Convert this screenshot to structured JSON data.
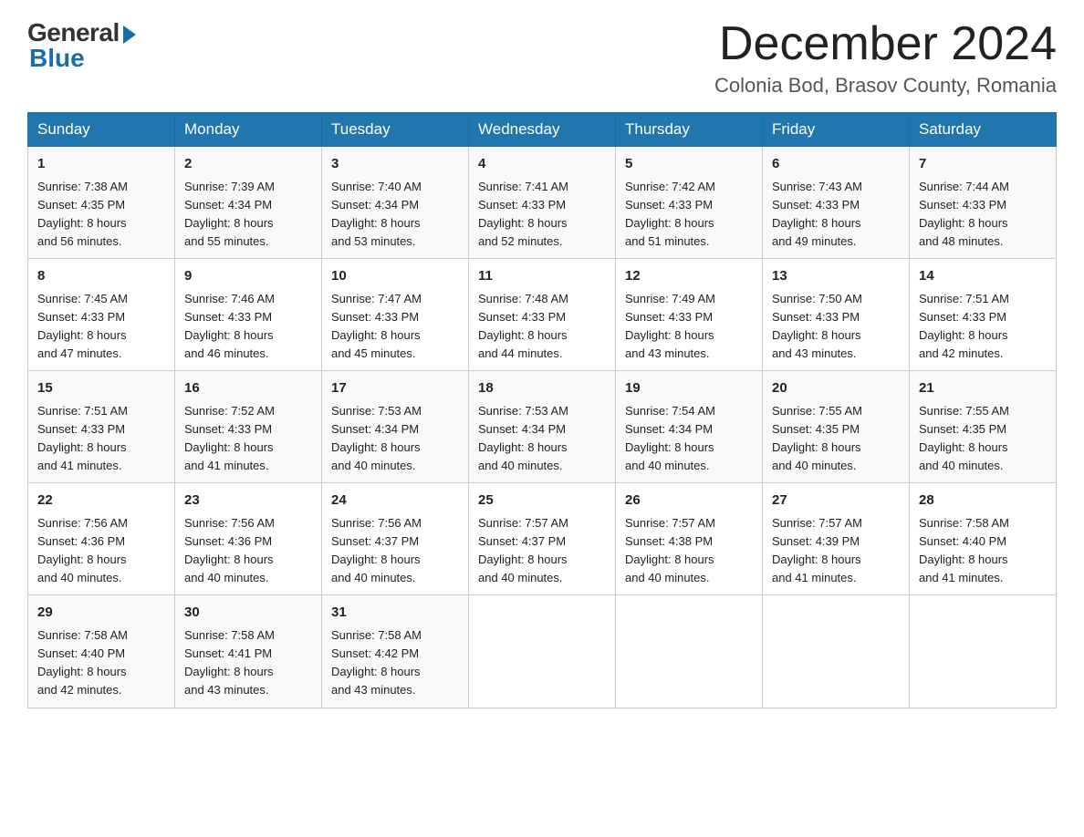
{
  "logo": {
    "general": "General",
    "blue": "Blue"
  },
  "title": "December 2024",
  "location": "Colonia Bod, Brasov County, Romania",
  "days_of_week": [
    "Sunday",
    "Monday",
    "Tuesday",
    "Wednesday",
    "Thursday",
    "Friday",
    "Saturday"
  ],
  "weeks": [
    [
      {
        "day": "1",
        "sunrise": "7:38 AM",
        "sunset": "4:35 PM",
        "daylight": "8 hours and 56 minutes."
      },
      {
        "day": "2",
        "sunrise": "7:39 AM",
        "sunset": "4:34 PM",
        "daylight": "8 hours and 55 minutes."
      },
      {
        "day": "3",
        "sunrise": "7:40 AM",
        "sunset": "4:34 PM",
        "daylight": "8 hours and 53 minutes."
      },
      {
        "day": "4",
        "sunrise": "7:41 AM",
        "sunset": "4:33 PM",
        "daylight": "8 hours and 52 minutes."
      },
      {
        "day": "5",
        "sunrise": "7:42 AM",
        "sunset": "4:33 PM",
        "daylight": "8 hours and 51 minutes."
      },
      {
        "day": "6",
        "sunrise": "7:43 AM",
        "sunset": "4:33 PM",
        "daylight": "8 hours and 49 minutes."
      },
      {
        "day": "7",
        "sunrise": "7:44 AM",
        "sunset": "4:33 PM",
        "daylight": "8 hours and 48 minutes."
      }
    ],
    [
      {
        "day": "8",
        "sunrise": "7:45 AM",
        "sunset": "4:33 PM",
        "daylight": "8 hours and 47 minutes."
      },
      {
        "day": "9",
        "sunrise": "7:46 AM",
        "sunset": "4:33 PM",
        "daylight": "8 hours and 46 minutes."
      },
      {
        "day": "10",
        "sunrise": "7:47 AM",
        "sunset": "4:33 PM",
        "daylight": "8 hours and 45 minutes."
      },
      {
        "day": "11",
        "sunrise": "7:48 AM",
        "sunset": "4:33 PM",
        "daylight": "8 hours and 44 minutes."
      },
      {
        "day": "12",
        "sunrise": "7:49 AM",
        "sunset": "4:33 PM",
        "daylight": "8 hours and 43 minutes."
      },
      {
        "day": "13",
        "sunrise": "7:50 AM",
        "sunset": "4:33 PM",
        "daylight": "8 hours and 43 minutes."
      },
      {
        "day": "14",
        "sunrise": "7:51 AM",
        "sunset": "4:33 PM",
        "daylight": "8 hours and 42 minutes."
      }
    ],
    [
      {
        "day": "15",
        "sunrise": "7:51 AM",
        "sunset": "4:33 PM",
        "daylight": "8 hours and 41 minutes."
      },
      {
        "day": "16",
        "sunrise": "7:52 AM",
        "sunset": "4:33 PM",
        "daylight": "8 hours and 41 minutes."
      },
      {
        "day": "17",
        "sunrise": "7:53 AM",
        "sunset": "4:34 PM",
        "daylight": "8 hours and 40 minutes."
      },
      {
        "day": "18",
        "sunrise": "7:53 AM",
        "sunset": "4:34 PM",
        "daylight": "8 hours and 40 minutes."
      },
      {
        "day": "19",
        "sunrise": "7:54 AM",
        "sunset": "4:34 PM",
        "daylight": "8 hours and 40 minutes."
      },
      {
        "day": "20",
        "sunrise": "7:55 AM",
        "sunset": "4:35 PM",
        "daylight": "8 hours and 40 minutes."
      },
      {
        "day": "21",
        "sunrise": "7:55 AM",
        "sunset": "4:35 PM",
        "daylight": "8 hours and 40 minutes."
      }
    ],
    [
      {
        "day": "22",
        "sunrise": "7:56 AM",
        "sunset": "4:36 PM",
        "daylight": "8 hours and 40 minutes."
      },
      {
        "day": "23",
        "sunrise": "7:56 AM",
        "sunset": "4:36 PM",
        "daylight": "8 hours and 40 minutes."
      },
      {
        "day": "24",
        "sunrise": "7:56 AM",
        "sunset": "4:37 PM",
        "daylight": "8 hours and 40 minutes."
      },
      {
        "day": "25",
        "sunrise": "7:57 AM",
        "sunset": "4:37 PM",
        "daylight": "8 hours and 40 minutes."
      },
      {
        "day": "26",
        "sunrise": "7:57 AM",
        "sunset": "4:38 PM",
        "daylight": "8 hours and 40 minutes."
      },
      {
        "day": "27",
        "sunrise": "7:57 AM",
        "sunset": "4:39 PM",
        "daylight": "8 hours and 41 minutes."
      },
      {
        "day": "28",
        "sunrise": "7:58 AM",
        "sunset": "4:40 PM",
        "daylight": "8 hours and 41 minutes."
      }
    ],
    [
      {
        "day": "29",
        "sunrise": "7:58 AM",
        "sunset": "4:40 PM",
        "daylight": "8 hours and 42 minutes."
      },
      {
        "day": "30",
        "sunrise": "7:58 AM",
        "sunset": "4:41 PM",
        "daylight": "8 hours and 43 minutes."
      },
      {
        "day": "31",
        "sunrise": "7:58 AM",
        "sunset": "4:42 PM",
        "daylight": "8 hours and 43 minutes."
      },
      null,
      null,
      null,
      null
    ]
  ],
  "labels": {
    "sunrise": "Sunrise:",
    "sunset": "Sunset:",
    "daylight": "Daylight:"
  }
}
